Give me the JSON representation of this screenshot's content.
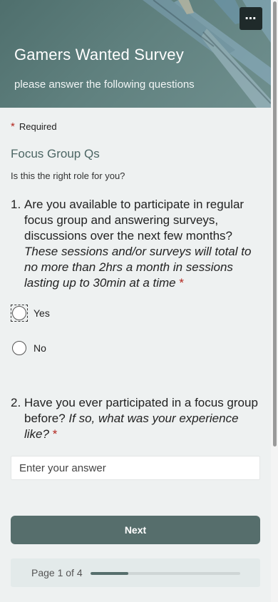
{
  "header": {
    "title": "Gamers Wanted Survey",
    "subtitle": "please answer the following questions",
    "more_label": "⋯"
  },
  "required_note": {
    "star": "*",
    "label": "Required"
  },
  "section": {
    "title": "Focus Group Qs",
    "description": "Is this the right role for you?"
  },
  "questions": [
    {
      "number": "1.",
      "text": "Are you available to participate in regular focus group and answering surveys, discussions over the next few months?",
      "italic_text": "These sessions and/or surveys will total to no more than 2hrs a month in sessions lasting up to 30min at a time",
      "required_star": "*",
      "options": [
        "Yes",
        "No"
      ]
    },
    {
      "number": "2.",
      "text": "Have you ever participated in a focus group before?",
      "italic_text": "If so, what was your experience like?",
      "required_star": "*",
      "placeholder": "Enter your answer"
    }
  ],
  "footer": {
    "next_label": "Next",
    "progress_text": "Page 1 of 4",
    "progress_fraction": 0.25
  },
  "colors": {
    "accent": "#566e6c",
    "required": "#b3261e",
    "background": "#eef1f1"
  }
}
